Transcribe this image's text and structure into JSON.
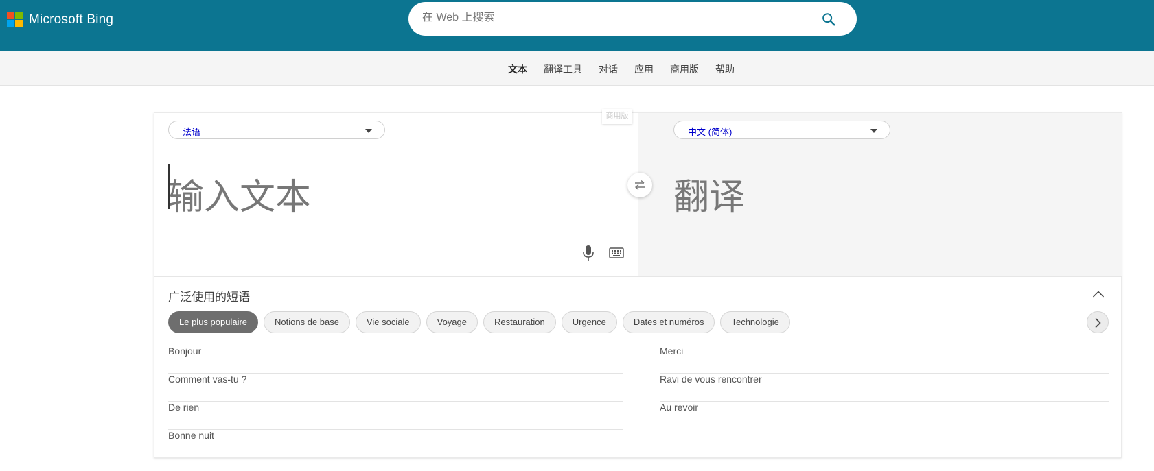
{
  "header": {
    "brand": "Microsoft Bing",
    "logo_colors": [
      "#f25022",
      "#7fba00",
      "#00a4ef",
      "#ffb900"
    ],
    "search_placeholder": "在 Web 上搜索",
    "background_color": "#0c7591"
  },
  "nav": {
    "items": [
      "文本",
      "翻译工具",
      "对话",
      "应用",
      "商用版",
      "帮助"
    ],
    "active": "文本"
  },
  "translator": {
    "source_language": "法语",
    "target_language": "中文 (简体)",
    "source_placeholder": "输入文本",
    "target_placeholder": "翻译",
    "pro_tag": "商用版"
  },
  "phrases": {
    "title": "广泛使用的短语",
    "categories": [
      "Le plus populaire",
      "Notions de base",
      "Vie sociale",
      "Voyage",
      "Restauration",
      "Urgence",
      "Dates et numéros",
      "Technologie"
    ],
    "selected_category": "Le plus populaire",
    "left_column": [
      "Bonjour",
      "Comment vas-tu ?",
      "De rien",
      "Bonne nuit"
    ],
    "right_column": [
      "Merci",
      "Ravi de vous rencontrer",
      "Au revoir"
    ]
  }
}
